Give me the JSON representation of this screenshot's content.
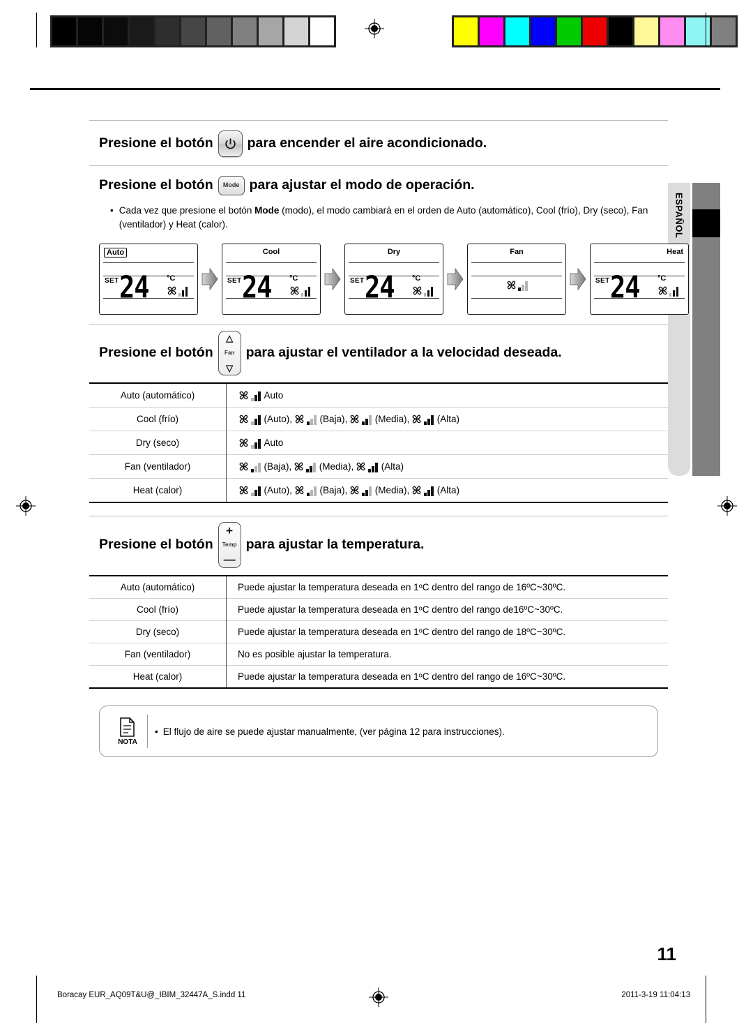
{
  "calibration": {
    "grayscale_patches": [
      "#000000",
      "#050505",
      "#0c0c0c",
      "#1a1a1a",
      "#2e2e2e",
      "#464646",
      "#616161",
      "#808080",
      "#a6a6a6",
      "#d4d4d4",
      "#ffffff"
    ],
    "color_patches": [
      "#ffff00",
      "#ff00ff",
      "#00ffff",
      "#0000ff",
      "#00cc00",
      "#ee0000",
      "#000000",
      "#fff79a",
      "#ff8cf0",
      "#8ff4f4",
      "#808080"
    ]
  },
  "language_tab": {
    "label": "ESPAÑOL"
  },
  "sections": {
    "power": {
      "prefix": "Presione el botón",
      "button_icon": "power-icon",
      "suffix": "para encender el aire acondicionado."
    },
    "mode": {
      "prefix": "Presione el botón",
      "button_label": "Mode",
      "suffix": "para ajustar el modo de operación.",
      "bullet": {
        "dot": "•",
        "part1": "Cada vez que presione el botón ",
        "bold": "Mode",
        "part2": "  (modo), el modo cambiará en el orden de Auto (automático), Cool (frío), Dry (seco), Fan (ventilador) y Heat (calor)."
      },
      "displays": [
        {
          "mode": "Auto",
          "align": "left",
          "set": "SET",
          "temp": "24",
          "unit": "°C",
          "show_temp": true,
          "fan_bars": [
            "off",
            "on",
            "on"
          ]
        },
        {
          "mode": "Cool",
          "align": "center",
          "set": "SET",
          "temp": "24",
          "unit": "°C",
          "show_temp": true,
          "fan_bars": [
            "off",
            "on",
            "on"
          ]
        },
        {
          "mode": "Dry",
          "align": "center",
          "set": "SET",
          "temp": "24",
          "unit": "°C",
          "show_temp": true,
          "fan_bars": [
            "off",
            "on",
            "on"
          ]
        },
        {
          "mode": "Fan",
          "align": "center",
          "set": "",
          "temp": "",
          "unit": "",
          "show_temp": false,
          "fan_bars": [
            "on",
            "off",
            "off"
          ]
        },
        {
          "mode": "Heat",
          "align": "right",
          "set": "SET",
          "temp": "24",
          "unit": "°C",
          "show_temp": true,
          "fan_bars": [
            "off",
            "on",
            "on"
          ]
        }
      ]
    },
    "fan": {
      "prefix": "Presione el botón",
      "button_label": "Fan",
      "suffix": "para ajustar el ventilador a la velocidad deseada.",
      "rows": [
        {
          "label": "Auto (automático)",
          "speeds": [
            {
              "bars": [
                "off",
                "on",
                "on"
              ],
              "cap": "Auto"
            }
          ]
        },
        {
          "label": "Cool (frío)",
          "speeds": [
            {
              "bars": [
                "off",
                "on",
                "on"
              ],
              "cap": "(Auto),"
            },
            {
              "bars": [
                "on",
                "off",
                "off"
              ],
              "cap": "(Baja),"
            },
            {
              "bars": [
                "on",
                "on",
                "off"
              ],
              "cap": "(Media),"
            },
            {
              "bars": [
                "on",
                "on",
                "on"
              ],
              "cap": "(Alta)"
            }
          ]
        },
        {
          "label": "Dry (seco)",
          "speeds": [
            {
              "bars": [
                "off",
                "on",
                "on"
              ],
              "cap": "Auto"
            }
          ]
        },
        {
          "label": "Fan (ventilador)",
          "speeds": [
            {
              "bars": [
                "on",
                "off",
                "off"
              ],
              "cap": "(Baja),"
            },
            {
              "bars": [
                "on",
                "on",
                "off"
              ],
              "cap": "(Media),"
            },
            {
              "bars": [
                "on",
                "on",
                "on"
              ],
              "cap": "(Alta)"
            }
          ]
        },
        {
          "label": "Heat (calor)",
          "speeds": [
            {
              "bars": [
                "off",
                "on",
                "on"
              ],
              "cap": "(Auto),"
            },
            {
              "bars": [
                "on",
                "off",
                "off"
              ],
              "cap": "(Baja),"
            },
            {
              "bars": [
                "on",
                "on",
                "off"
              ],
              "cap": "(Media),"
            },
            {
              "bars": [
                "on",
                "on",
                "on"
              ],
              "cap": "(Alta)"
            }
          ]
        }
      ]
    },
    "temp": {
      "prefix": "Presione el botón",
      "button_plus": "+",
      "button_label": "Temp",
      "button_minus": "—",
      "suffix": "para ajustar la temperatura.",
      "rows": [
        {
          "label": "Auto (automático)",
          "value": "Puede ajustar la temperatura deseada en 1ᵒC dentro del rango de 16ºC~30ºC."
        },
        {
          "label": "Cool (frío)",
          "value": "Puede ajustar la temperatura deseada en 1ᵒC dentro del rango de16ºC~30ºC."
        },
        {
          "label": "Dry (seco)",
          "value": "Puede ajustar la temperatura deseada en 1ᵒC dentro del rango de 18ºC~30ºC."
        },
        {
          "label": "Fan (ventilador)",
          "value": "No es posible ajustar la temperatura."
        },
        {
          "label": "Heat (calor)",
          "value": "Puede ajustar la temperatura deseada en 1ᵒC dentro del rango de 16ºC~30ºC."
        }
      ]
    },
    "note": {
      "icon_label": "NOTA",
      "dot": "•",
      "text": "El flujo de aire se puede ajustar manualmente, (ver página 12 para instrucciones)."
    }
  },
  "page_number": "11",
  "footer": {
    "file": "Boracay EUR_AQ09T&U@_IBIM_32447A_S.indd   11",
    "timestamp": "2011-3-19   11:04:13"
  }
}
